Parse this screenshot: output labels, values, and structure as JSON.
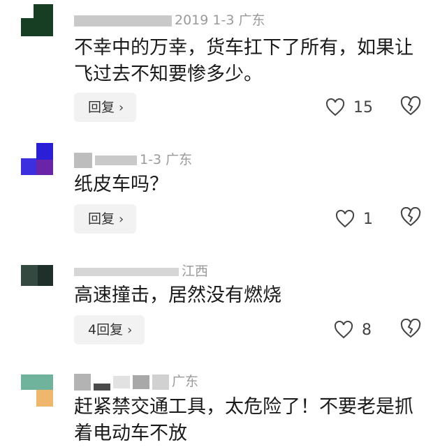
{
  "comments": [
    {
      "meta_text": "2019 1-3 广东",
      "body": "不幸中的万幸，货车扛下了所有，如果让飞过去不知要惨多少。",
      "reply_label": "回复",
      "likes": "15",
      "avatar_colors": [
        "#173d22",
        "#ffffff"
      ]
    },
    {
      "meta_text": "1-3 广东",
      "body": "纸皮车吗？",
      "reply_label": "回复",
      "likes": "1",
      "avatar_colors": [
        "#2a1fd6",
        "#6a24a8",
        "#3b2fe0"
      ]
    },
    {
      "meta_text": "江西",
      "body": "高速撞击，居然没有燃烧",
      "reply_label": "4回复",
      "likes": "8",
      "avatar_colors": [
        "#344a41",
        "#7a8a85"
      ]
    },
    {
      "meta_text": "广东",
      "body": "赶紧禁交通工具，太危险了！不要老是抓着电动车不放",
      "avatar_colors": [
        "#6fb39c",
        "#f0b66c"
      ]
    }
  ],
  "icons": {
    "like": "heart-outline-icon",
    "dislike": "broken-heart-icon",
    "reply_chevron": "chevron-right-icon"
  },
  "colors": {
    "text": "#1a1a1a",
    "meta": "#9a9a9a",
    "reply_bg": "#f2f2f2"
  }
}
